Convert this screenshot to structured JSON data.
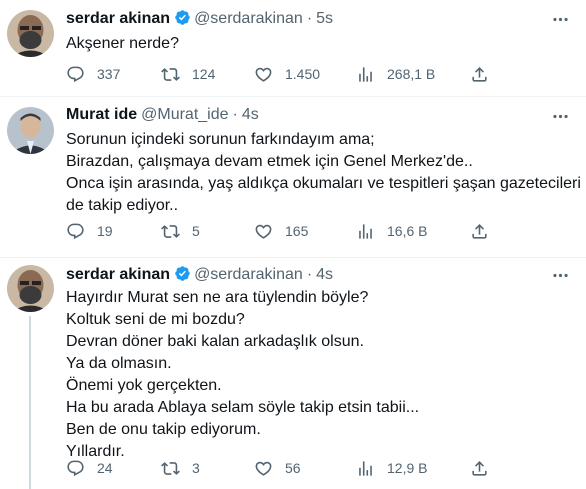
{
  "tweets": [
    {
      "name": "serdar akinan",
      "verified": true,
      "handle": "@serdarakinan",
      "time": "5s",
      "lines": [
        "Akşener nerde?"
      ],
      "replies": "337",
      "retweets": "124",
      "likes": "1.450",
      "views": "268,1 B"
    },
    {
      "name": "Murat ide",
      "verified": false,
      "handle": "@Murat_ide",
      "time": "4s",
      "lines": [
        "Sorunun içindeki sorunun farkındayım ama;",
        "Birazdan, çalışmaya devam etmek için Genel Merkez'de..",
        "Onca işin arasında, yaş aldıkça okumaları ve tespitleri şaşan gazetecileri",
        "de takip ediyor.."
      ],
      "replies": "19",
      "retweets": "5",
      "likes": "165",
      "views": "16,6 B"
    },
    {
      "name": "serdar akinan",
      "verified": true,
      "handle": "@serdarakinan",
      "time": "4s",
      "lines": [
        "Hayırdır Murat sen ne ara tüylendin böyle?",
        "Koltuk seni de mi bozdu?",
        "Devran döner baki kalan arkadaşlık olsun.",
        "Ya da olmasın.",
        "Önemi yok gerçekten.",
        "Ha bu arada Ablaya selam söyle takip etsin tabii...",
        "Ben de onu takip ediyorum.",
        "Yıllardır."
      ],
      "replies": "24",
      "retweets": "3",
      "likes": "56",
      "views": "12,9 B"
    }
  ],
  "separator": "·",
  "colors": {
    "text": "#0f1419",
    "secondary": "#536471",
    "verified": "#1d9bf0",
    "divider": "#eff3f4"
  },
  "icons": [
    "reply-icon",
    "retweet-icon",
    "like-icon",
    "views-icon",
    "share-icon",
    "more-icon",
    "verified-badge-icon"
  ]
}
